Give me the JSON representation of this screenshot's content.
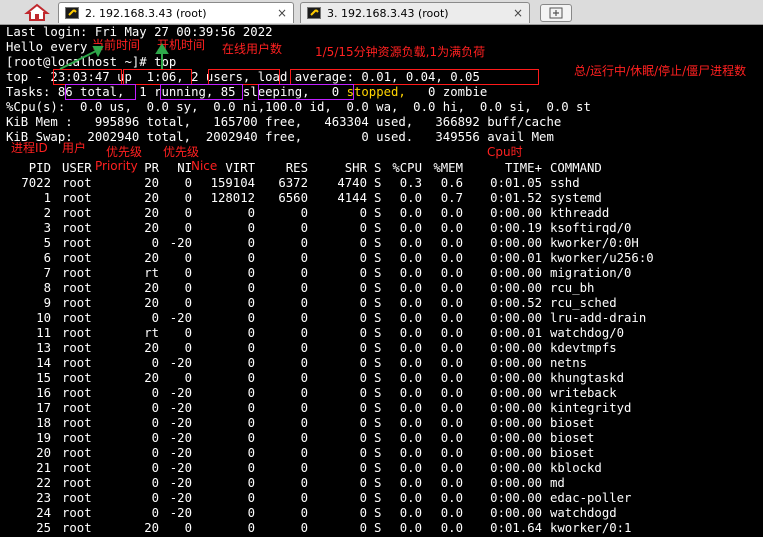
{
  "tabs": [
    {
      "label": "2. 192.168.3.43 (root)",
      "active": true,
      "icon": "terminal-icon"
    },
    {
      "label": "3. 192.168.3.43 (root)",
      "active": false,
      "icon": "terminal-icon"
    }
  ],
  "toolbar": {
    "home_icon": "home-icon",
    "new_tab_icon": "new-tab-icon"
  },
  "terminal": {
    "last_login": "Last login: Fri May 27 00:39:56 2022",
    "greeting": "Hello every",
    "prompt_prefix": "[root@",
    "prompt_host": "localhost",
    "prompt_suffix": " ~]# ",
    "command": "top",
    "top_line": {
      "prefix": "top - ",
      "time": "23:03:47",
      "up": "up  1:06,",
      "users": " 2 users,",
      "load": " load average: 0.01, 0.04, 0.05"
    },
    "tasks_line": {
      "prefix": "Tasks:",
      "total": " 86 total,",
      "running": "  1 running,",
      "sleeping": " 85 sleeping,",
      "stopped_count": "   0 ",
      "stopped_word": "stopped,",
      "zombie": "   0 zombie"
    },
    "cpu_line": "%Cpu(s):  0.0 us,  0.0 sy,  0.0 ni,100.0 id,  0.0 wa,  0.0 hi,  0.0 si,  0.0 st",
    "mem_line": "KiB Mem :   995896 total,   165700 free,   463304 used,   366892 buff/cache",
    "swap_line": "KiB Swap:  2002940 total,  2002940 free,        0 used.   349556 avail Mem"
  },
  "table": {
    "headers": [
      "PID",
      "USER",
      "PR",
      "NI",
      "VIRT",
      "RES",
      "SHR",
      "S",
      "%CPU",
      "%MEM",
      "TIME+",
      "COMMAND"
    ],
    "rows": [
      [
        "7022",
        "root",
        "20",
        "0",
        "159104",
        "6372",
        "4740",
        "S",
        "0.3",
        "0.6",
        "0:01.05",
        "sshd"
      ],
      [
        "1",
        "root",
        "20",
        "0",
        "128012",
        "6560",
        "4144",
        "S",
        "0.0",
        "0.7",
        "0:01.52",
        "systemd"
      ],
      [
        "2",
        "root",
        "20",
        "0",
        "0",
        "0",
        "0",
        "S",
        "0.0",
        "0.0",
        "0:00.00",
        "kthreadd"
      ],
      [
        "3",
        "root",
        "20",
        "0",
        "0",
        "0",
        "0",
        "S",
        "0.0",
        "0.0",
        "0:00.19",
        "ksoftirqd/0"
      ],
      [
        "5",
        "root",
        "0",
        "-20",
        "0",
        "0",
        "0",
        "S",
        "0.0",
        "0.0",
        "0:00.00",
        "kworker/0:0H"
      ],
      [
        "6",
        "root",
        "20",
        "0",
        "0",
        "0",
        "0",
        "S",
        "0.0",
        "0.0",
        "0:00.01",
        "kworker/u256:0"
      ],
      [
        "7",
        "root",
        "rt",
        "0",
        "0",
        "0",
        "0",
        "S",
        "0.0",
        "0.0",
        "0:00.00",
        "migration/0"
      ],
      [
        "8",
        "root",
        "20",
        "0",
        "0",
        "0",
        "0",
        "S",
        "0.0",
        "0.0",
        "0:00.00",
        "rcu_bh"
      ],
      [
        "9",
        "root",
        "20",
        "0",
        "0",
        "0",
        "0",
        "S",
        "0.0",
        "0.0",
        "0:00.52",
        "rcu_sched"
      ],
      [
        "10",
        "root",
        "0",
        "-20",
        "0",
        "0",
        "0",
        "S",
        "0.0",
        "0.0",
        "0:00.00",
        "lru-add-drain"
      ],
      [
        "11",
        "root",
        "rt",
        "0",
        "0",
        "0",
        "0",
        "S",
        "0.0",
        "0.0",
        "0:00.01",
        "watchdog/0"
      ],
      [
        "13",
        "root",
        "20",
        "0",
        "0",
        "0",
        "0",
        "S",
        "0.0",
        "0.0",
        "0:00.00",
        "kdevtmpfs"
      ],
      [
        "14",
        "root",
        "0",
        "-20",
        "0",
        "0",
        "0",
        "S",
        "0.0",
        "0.0",
        "0:00.00",
        "netns"
      ],
      [
        "15",
        "root",
        "20",
        "0",
        "0",
        "0",
        "0",
        "S",
        "0.0",
        "0.0",
        "0:00.00",
        "khungtaskd"
      ],
      [
        "16",
        "root",
        "0",
        "-20",
        "0",
        "0",
        "0",
        "S",
        "0.0",
        "0.0",
        "0:00.00",
        "writeback"
      ],
      [
        "17",
        "root",
        "0",
        "-20",
        "0",
        "0",
        "0",
        "S",
        "0.0",
        "0.0",
        "0:00.00",
        "kintegrityd"
      ],
      [
        "18",
        "root",
        "0",
        "-20",
        "0",
        "0",
        "0",
        "S",
        "0.0",
        "0.0",
        "0:00.00",
        "bioset"
      ],
      [
        "19",
        "root",
        "0",
        "-20",
        "0",
        "0",
        "0",
        "S",
        "0.0",
        "0.0",
        "0:00.00",
        "bioset"
      ],
      [
        "20",
        "root",
        "0",
        "-20",
        "0",
        "0",
        "0",
        "S",
        "0.0",
        "0.0",
        "0:00.00",
        "bioset"
      ],
      [
        "21",
        "root",
        "0",
        "-20",
        "0",
        "0",
        "0",
        "S",
        "0.0",
        "0.0",
        "0:00.00",
        "kblockd"
      ],
      [
        "22",
        "root",
        "0",
        "-20",
        "0",
        "0",
        "0",
        "S",
        "0.0",
        "0.0",
        "0:00.00",
        "md"
      ],
      [
        "23",
        "root",
        "0",
        "-20",
        "0",
        "0",
        "0",
        "S",
        "0.0",
        "0.0",
        "0:00.00",
        "edac-poller"
      ],
      [
        "24",
        "root",
        "0",
        "-20",
        "0",
        "0",
        "0",
        "S",
        "0.0",
        "0.0",
        "0:00.00",
        "watchdogd"
      ],
      [
        "25",
        "root",
        "20",
        "0",
        "0",
        "0",
        "0",
        "S",
        "0.0",
        "0.0",
        "0:01.64",
        "kworker/0:1"
      ]
    ]
  },
  "annotations": {
    "current_time": "当前时间",
    "uptime": "开机时间",
    "online_users": "在线用户数",
    "load": "1/5/15分钟资源负载,1为满负荷",
    "task_states": "总/运行中/休眠/停止/僵尸进程数",
    "pid": "进程ID",
    "user": "用户",
    "priority": "优先级",
    "priority_en": "Priority",
    "nice": "优先级",
    "nice_en": "Nice",
    "cpu_time": "Cpu时",
    "accent_color": "#ff2020",
    "box_color_purple": "#c020ff",
    "arrow_color": "#2ea84a"
  }
}
